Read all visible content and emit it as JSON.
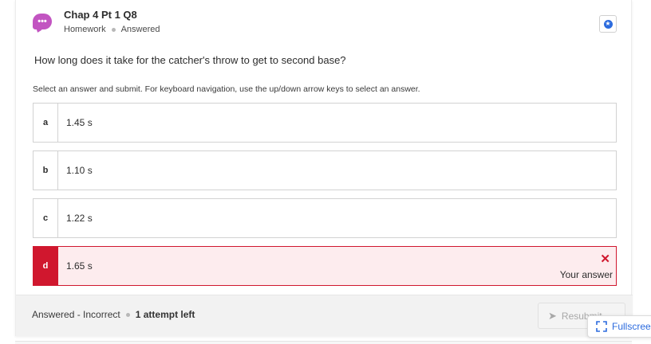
{
  "header": {
    "title": "Chap 4 Pt 1 Q8",
    "type": "Homework",
    "status": "Answered",
    "icon": "chat-bubble-icon",
    "bookmark_icon": "bookmark-star-icon"
  },
  "question": {
    "text": "How long does it take for the catcher's throw to get to second base?",
    "instructions": "Select an answer and submit. For keyboard navigation, use the up/down arrow keys to select an answer."
  },
  "options": [
    {
      "letter": "a",
      "text": "1.45 s",
      "selected": false
    },
    {
      "letter": "b",
      "text": "1.10 s",
      "selected": false
    },
    {
      "letter": "c",
      "text": "1.22 s",
      "selected": false
    },
    {
      "letter": "d",
      "text": "1.65 s",
      "selected": true,
      "result": "incorrect",
      "badge": "Your answer"
    }
  ],
  "footer": {
    "result": "Answered - Incorrect",
    "attempts": "1 attempt left",
    "resubmit_label": "Resubmit"
  },
  "fullscreen_label": "Fullscreen",
  "colors": {
    "accent": "#2c6bde",
    "error": "#d0172e",
    "error_bg": "#fdecee",
    "icon_purple": "#c254c1"
  }
}
